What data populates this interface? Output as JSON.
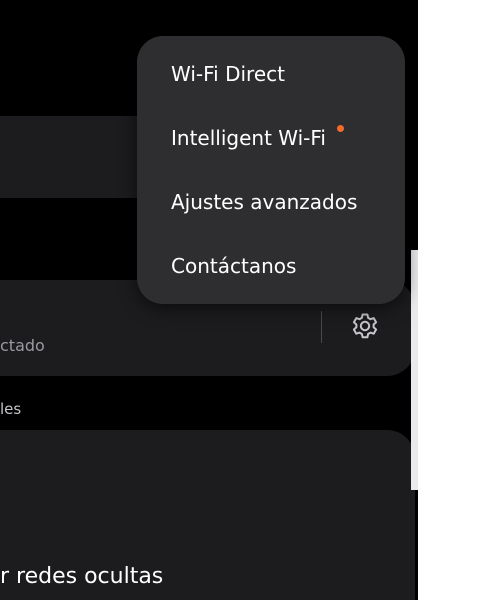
{
  "background": {
    "network_card": {
      "status_text": "ctado",
      "settings_icon": "gear-icon"
    },
    "section_label": "les",
    "hidden_networks_label": "r redes ocultas"
  },
  "overflow_menu": {
    "items": [
      {
        "label": "Wi-Fi Direct"
      },
      {
        "label": "Intelligent Wi-Fi",
        "badge": true
      },
      {
        "label": "Ajustes avanzados"
      },
      {
        "label": "Contáctanos"
      }
    ]
  },
  "colors": {
    "screen_background": "#000000",
    "card_background": "#1c1c1e",
    "menu_background": "#2e2e30",
    "badge_dot": "#f26b2b",
    "text_primary": "#ffffff",
    "text_secondary": "#9a9a9f"
  }
}
